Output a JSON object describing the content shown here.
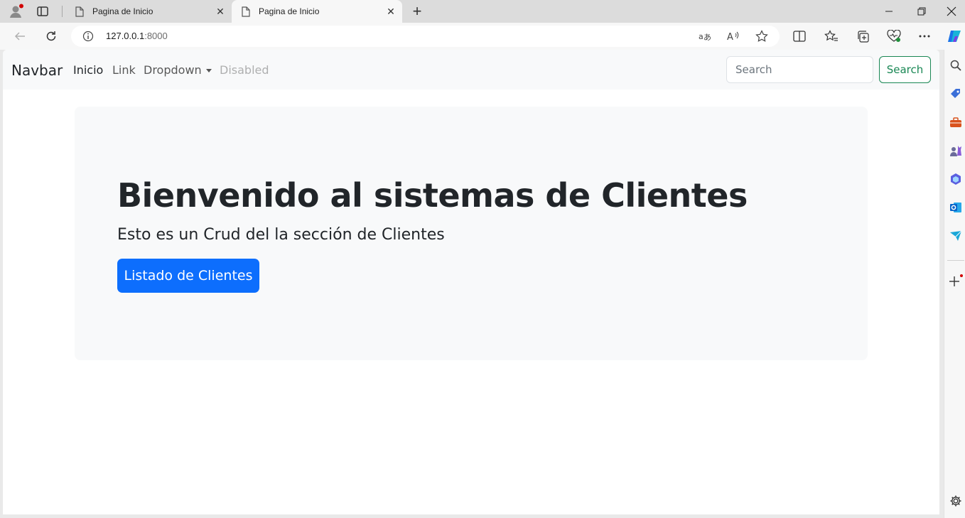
{
  "browser": {
    "tabs": [
      {
        "title": "Pagina de Inicio",
        "active": false
      },
      {
        "title": "Pagina de Inicio",
        "active": true
      }
    ],
    "address": {
      "host": "127.0.0.1",
      "port": ":8000"
    }
  },
  "navbar": {
    "brand": "Navbar",
    "links": [
      {
        "label": "Inicio",
        "state": "active"
      },
      {
        "label": "Link",
        "state": "normal"
      },
      {
        "label": "Dropdown",
        "state": "normal"
      },
      {
        "label": "Disabled",
        "state": "disabled"
      }
    ],
    "search": {
      "placeholder": "Search",
      "button_label": "Search"
    }
  },
  "hero": {
    "title": "Bienvenido al sistemas de Clientes",
    "lead": "Esto es un Crud del la sección de Clientes",
    "button_label": "Listado de Clientes"
  },
  "colors": {
    "primary": "#0d6efd",
    "success": "#198754",
    "light": "#f8f9fa",
    "dark_text": "#212529"
  }
}
